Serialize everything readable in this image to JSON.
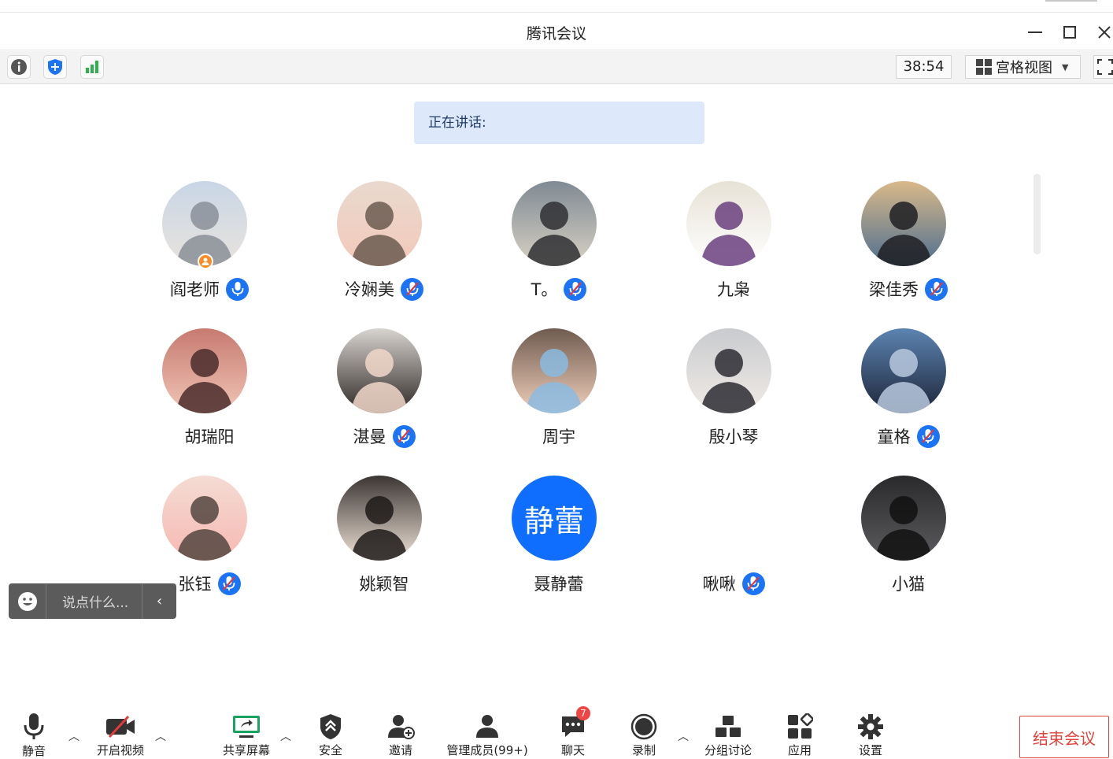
{
  "window": {
    "title": "腾讯会议"
  },
  "toolbar": {
    "timer": "38:54",
    "view_label": "宫格视图"
  },
  "speaking": {
    "label": "正在讲话:"
  },
  "participants": [
    {
      "name": "阎老师",
      "mic": "on",
      "host": true
    },
    {
      "name": "冷娴美",
      "mic": "muted"
    },
    {
      "name": "T。",
      "mic": "muted"
    },
    {
      "name": "九枭",
      "mic": "none"
    },
    {
      "name": "梁佳秀",
      "mic": "muted"
    },
    {
      "name": "胡瑞阳",
      "mic": "none"
    },
    {
      "name": "湛曼",
      "mic": "muted"
    },
    {
      "name": "周宇",
      "mic": "none"
    },
    {
      "name": "殷小琴",
      "mic": "none"
    },
    {
      "name": "童格",
      "mic": "muted"
    },
    {
      "name": "张钰",
      "mic": "muted"
    },
    {
      "name": "姚颖智",
      "mic": "none"
    },
    {
      "name": "聂静蕾",
      "mic": "none",
      "avatar_text": "静蕾"
    },
    {
      "name": "啾啾",
      "mic": "muted"
    },
    {
      "name": "小猫",
      "mic": "none"
    }
  ],
  "chat": {
    "placeholder": "说点什么..."
  },
  "bottom": {
    "mute": "静音",
    "video": "开启视频",
    "share": "共享屏幕",
    "security": "安全",
    "invite": "邀请",
    "members": "管理成员(99+)",
    "chat": "聊天",
    "chat_badge": "7",
    "record": "录制",
    "breakout": "分组讨论",
    "apps": "应用",
    "settings": "设置",
    "end": "结束会议"
  },
  "colors": {
    "accent": "#1b73f5",
    "end": "#e2433b",
    "badge": "#f04545"
  }
}
